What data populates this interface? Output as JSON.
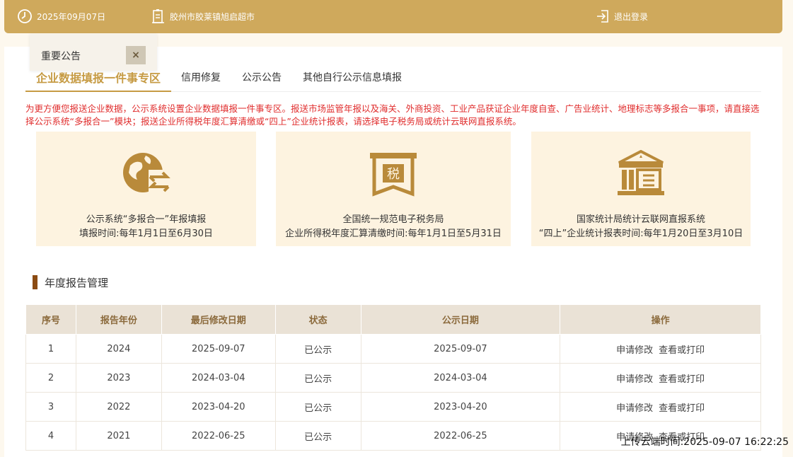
{
  "topbar": {
    "date": "2025年09月07日",
    "company": "胶州市胶莱镇旭启超市",
    "logout": "退出登录",
    "icons": [
      "clock-icon",
      "building-icon",
      "logout-icon"
    ]
  },
  "notice": {
    "title": "重要公告",
    "close": "×"
  },
  "tabs": [
    {
      "label": "企业数据填报一件事专区",
      "active": true
    },
    {
      "label": "信用修复"
    },
    {
      "label": "公示公告"
    },
    {
      "label": "其他自行公示信息填报"
    }
  ],
  "description": "为更方便您报送企业数据，公示系统设置企业数据填报一件事专区。报送市场监管年报以及海关、外商投资、工业产品获证企业年度自查、广告业统计、地理标志等多报合一事项，请直接选择公示系统“多报合一”模块；报送企业所得税年度汇算清缴或“四上”企业统计报表，请选择电子税务局或统计云联网直报系统。",
  "cards": [
    {
      "line1": "公示系统“多报合一”年报填报",
      "line2": "填报时间:每年1月1日至6月30日",
      "icon": "globe-exchange-icon"
    },
    {
      "line1": "全国统一规范电子税务局",
      "line2": "企业所得税年度汇算清缴时间:每年1月1日至5月31日",
      "icon": "tax-ribbon-icon"
    },
    {
      "line1": "国家统计局统计云联网直报系统",
      "line2": "“四上”企业统计报表时间:每年1月20日至3月10日",
      "icon": "government-building-icon"
    }
  ],
  "section_title": "年度报告管理",
  "table": {
    "headers": [
      "序号",
      "报告年份",
      "最后修改日期",
      "状态",
      "公示日期",
      "操作"
    ],
    "rows": [
      [
        "1",
        "2024",
        "2025-09-07",
        "已公示",
        "2025-09-07"
      ],
      [
        "2",
        "2023",
        "2024-03-04",
        "已公示",
        "2024-03-04"
      ],
      [
        "3",
        "2022",
        "2023-04-20",
        "已公示",
        "2023-04-20"
      ],
      [
        "4",
        "2021",
        "2022-06-25",
        "已公示",
        "2022-06-25"
      ]
    ],
    "actions": [
      "申请修改",
      "查看或打印"
    ]
  },
  "upload_time": "上传云端时间:2025-09-07 16:22:25",
  "colors": {
    "gold": "#cfa95c",
    "accent": "#c69b44",
    "alert": "#e02d2d",
    "card_bg": "#fdf3e0"
  }
}
